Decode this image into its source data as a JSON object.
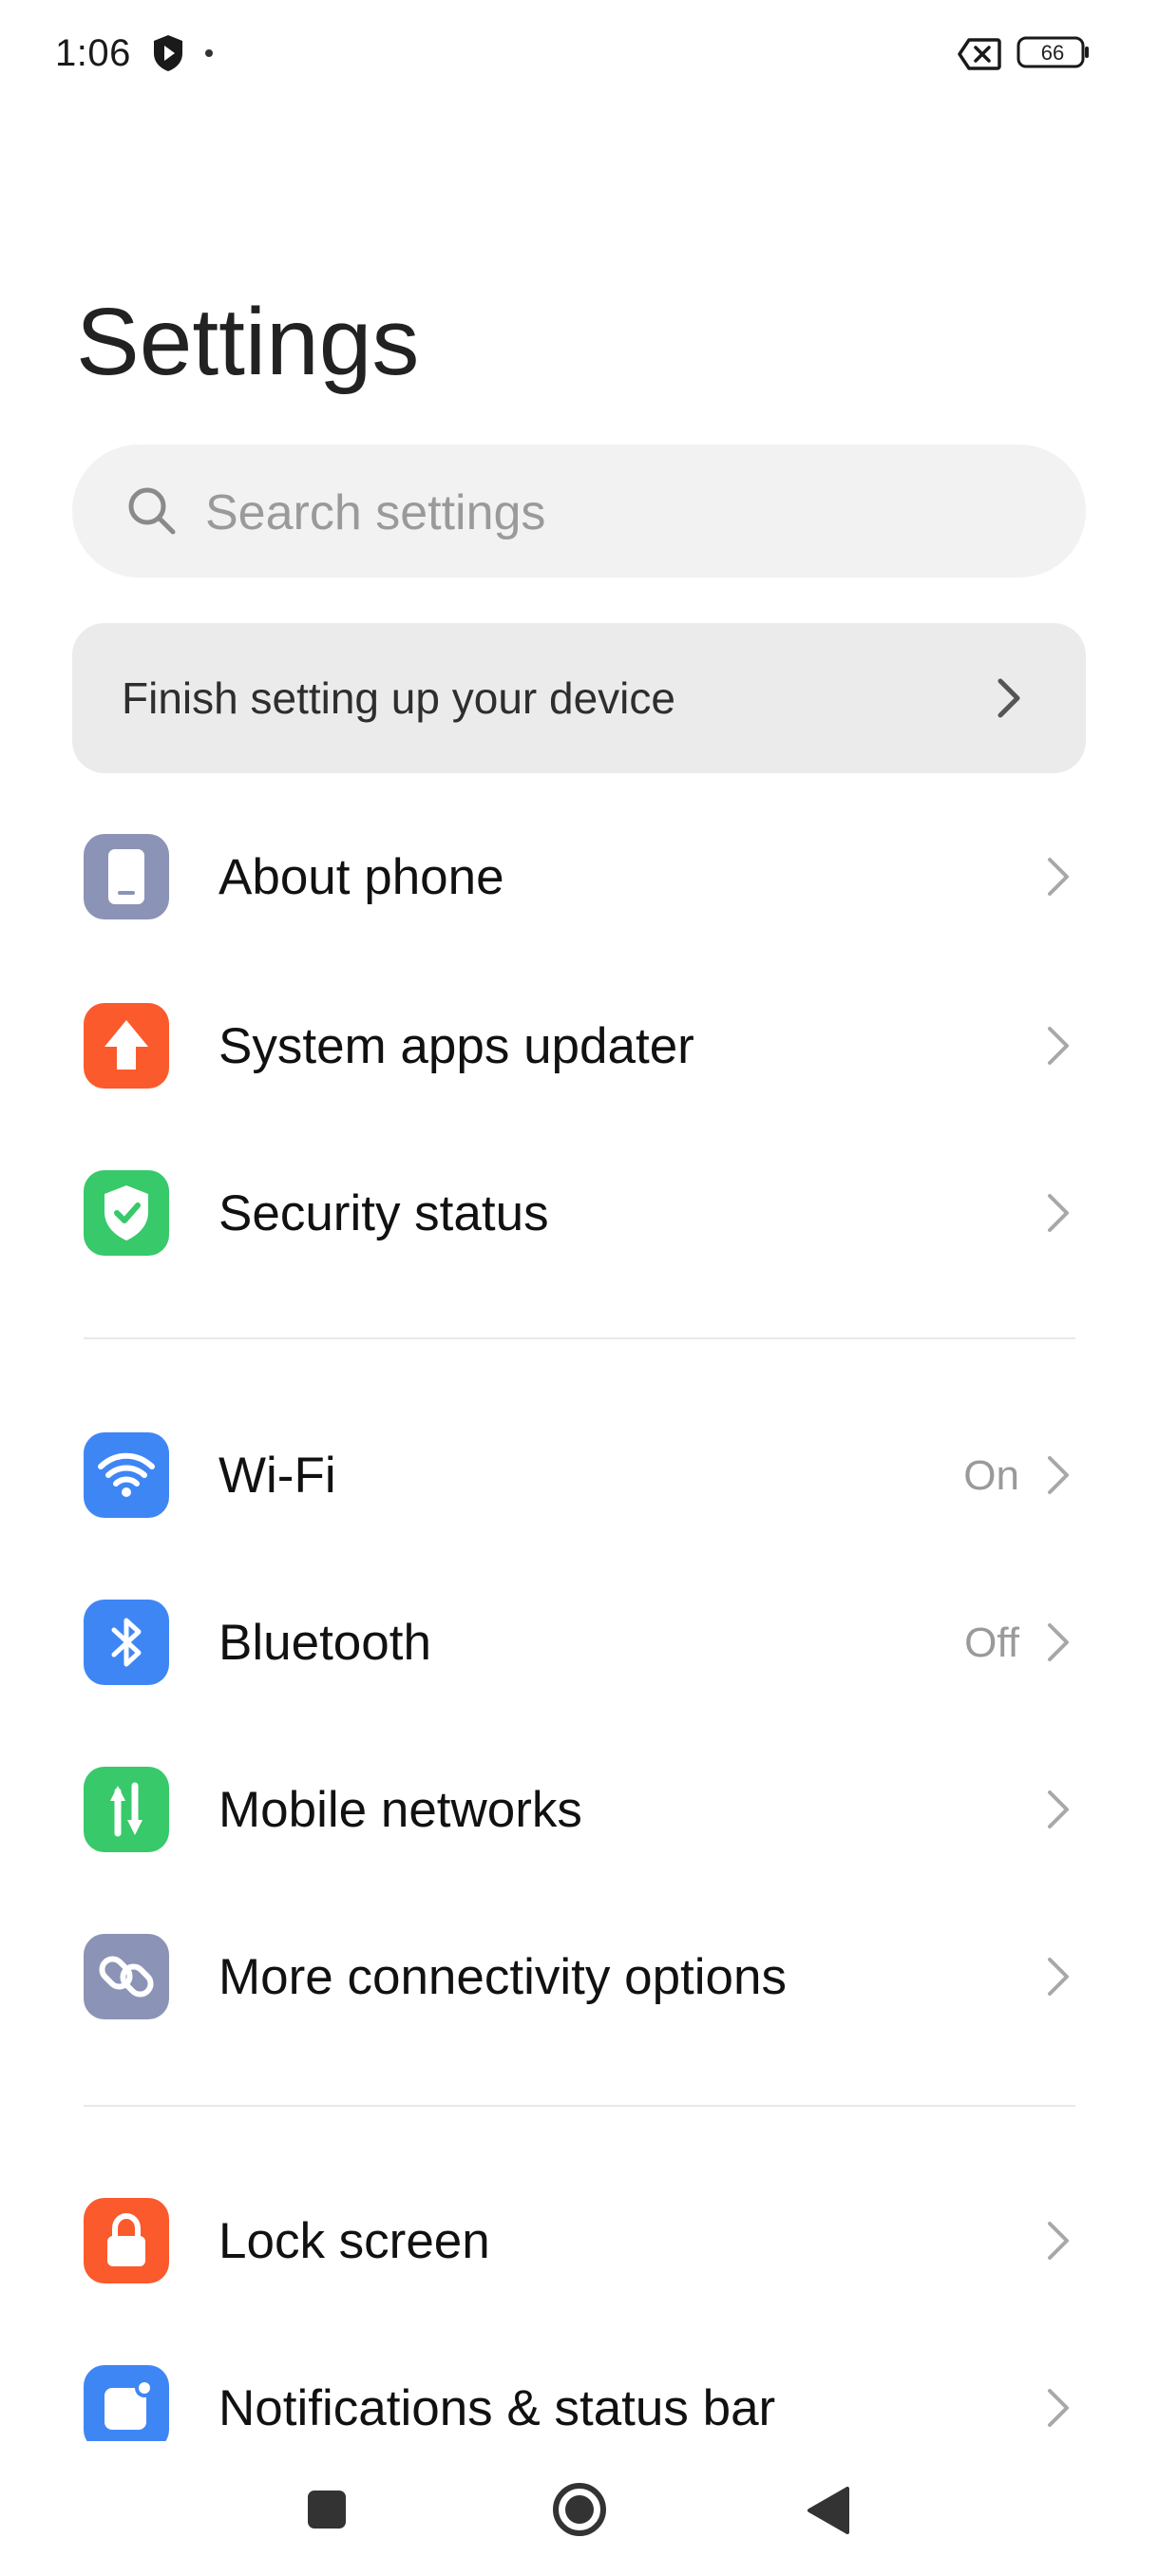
{
  "status_bar": {
    "time": "1:06",
    "battery": "66"
  },
  "title": "Settings",
  "search": {
    "placeholder": "Search settings"
  },
  "setup_card": {
    "label": "Finish setting up your device"
  },
  "groups": [
    [
      {
        "label": "About phone",
        "value": "",
        "icon": "phone-icon",
        "color": "#8b93b6"
      },
      {
        "label": "System apps updater",
        "value": "",
        "icon": "arrow-up-icon",
        "color": "#fb5a2c"
      },
      {
        "label": "Security status",
        "value": "",
        "icon": "shield-check-icon",
        "color": "#37c96a"
      }
    ],
    [
      {
        "label": "Wi-Fi",
        "value": "On",
        "icon": "wifi-icon",
        "color": "#3f86f5"
      },
      {
        "label": "Bluetooth",
        "value": "Off",
        "icon": "bluetooth-icon",
        "color": "#3f86f5"
      },
      {
        "label": "Mobile networks",
        "value": "",
        "icon": "mobile-data-icon",
        "color": "#37c96a"
      },
      {
        "label": "More connectivity options",
        "value": "",
        "icon": "link-icon",
        "color": "#8b93b6"
      }
    ],
    [
      {
        "label": "Lock screen",
        "value": "",
        "icon": "lock-icon",
        "color": "#fb5a2c"
      },
      {
        "label": "Notifications & status bar",
        "value": "",
        "icon": "notification-icon",
        "color": "#3f86f5"
      }
    ]
  ]
}
